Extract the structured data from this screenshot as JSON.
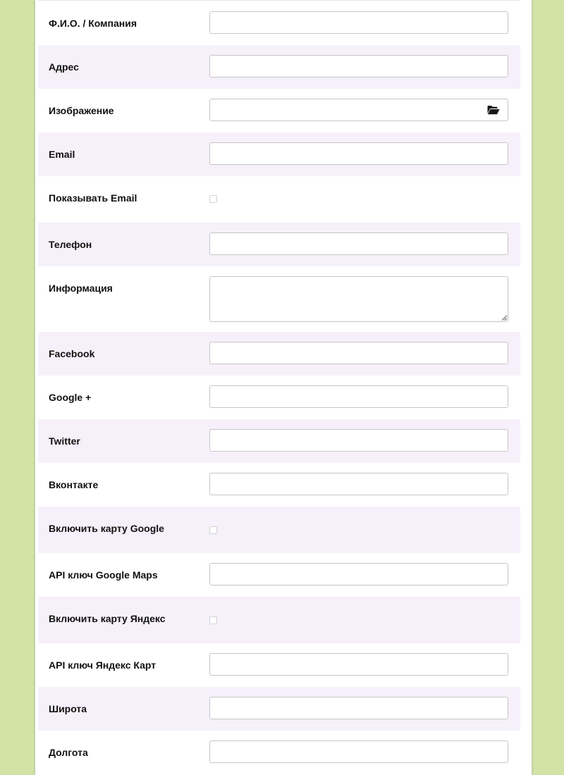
{
  "form": {
    "name_label": "Ф.И.О. / Компания",
    "name_value": "",
    "address_label": "Адрес",
    "address_value": "",
    "image_label": "Изображение",
    "image_value": "",
    "image_browse_icon": "folder-open-icon",
    "email_label": "Email",
    "email_value": "",
    "show_email_label": "Показывать Email",
    "show_email_checked": false,
    "phone_label": "Телефон",
    "phone_value": "",
    "info_label": "Информация",
    "info_value": "",
    "facebook_label": "Facebook",
    "facebook_value": "",
    "googleplus_label": "Google +",
    "googleplus_value": "",
    "twitter_label": "Twitter",
    "twitter_value": "",
    "vk_label": "Вконтакте",
    "vk_value": "",
    "google_map_label": "Включить карту Google",
    "google_map_checked": false,
    "google_api_label": "API ключ Google Maps",
    "google_api_value": "",
    "yandex_map_label": "Включить карту Яндекс",
    "yandex_map_checked": false,
    "yandex_api_label": "API ключ Яндекс Карт",
    "yandex_api_value": "",
    "latitude_label": "Широта",
    "latitude_value": "",
    "longitude_label": "Долгота",
    "longitude_value": ""
  },
  "colors": {
    "page_background": "#d1e3a6",
    "panel_background": "#ffffff",
    "alt_row_background": "#f5f0fa",
    "field_border": "#c6c6c6",
    "label_text": "#111111"
  }
}
